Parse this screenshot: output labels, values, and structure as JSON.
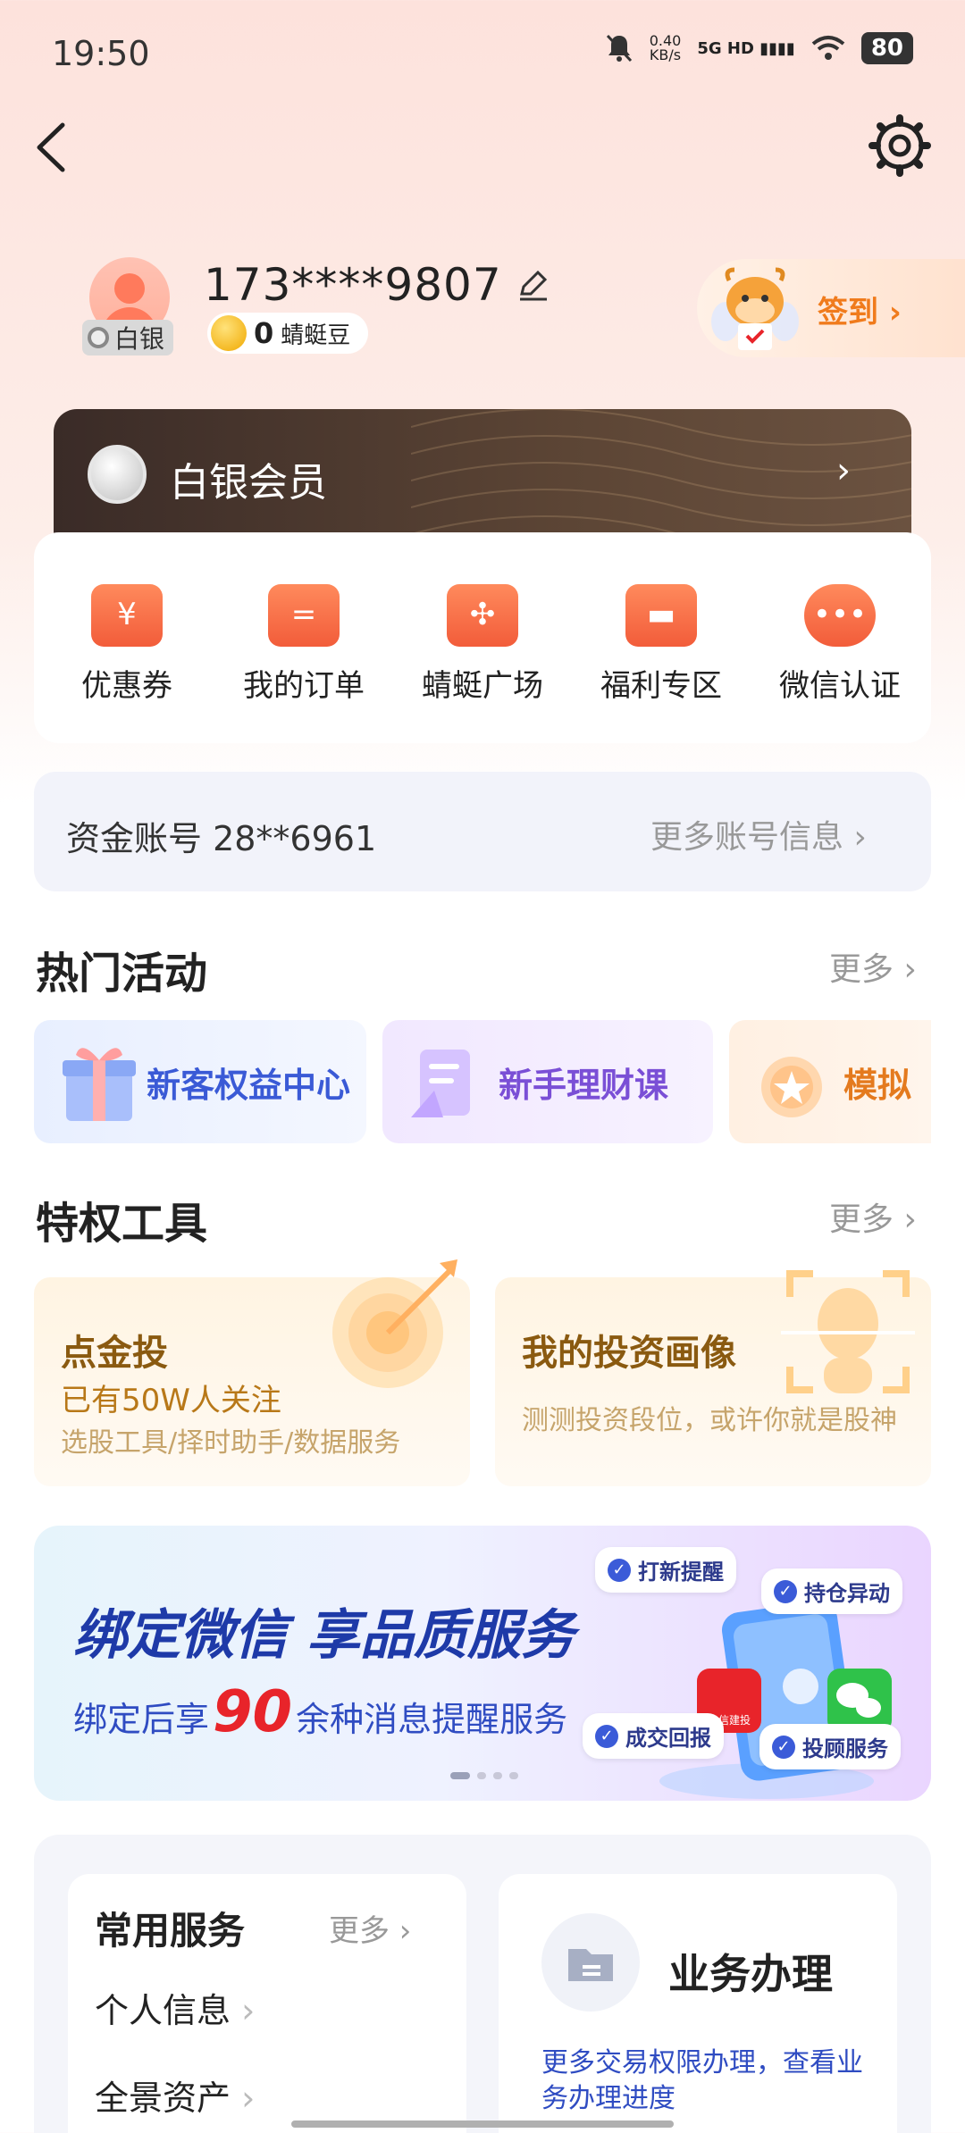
{
  "status_bar": {
    "time": "19:50",
    "net_speed_value": "0.40",
    "net_speed_unit": "KB/s",
    "network": "5G HD",
    "battery": "80"
  },
  "profile": {
    "phone": "173****9807",
    "tier": "白银",
    "beans_count": "0",
    "beans_label": "蜻蜓豆",
    "checkin_label": "签到"
  },
  "member": {
    "label": "白银会员"
  },
  "quick_actions": [
    {
      "label": "优惠券",
      "icon": "coupon-icon"
    },
    {
      "label": "我的订单",
      "icon": "order-icon"
    },
    {
      "label": "蜻蜓广场",
      "icon": "dragonfly-square-icon"
    },
    {
      "label": "福利专区",
      "icon": "gift-icon"
    },
    {
      "label": "微信认证",
      "icon": "wechat-verify-icon"
    }
  ],
  "fund_account": {
    "label": "资金账号 28**6961",
    "more": "更多账号信息"
  },
  "hot_activities": {
    "title": "热门活动",
    "more": "更多",
    "items": [
      "新客权益中心",
      "新手理财课",
      "模拟"
    ]
  },
  "privilege_tools": {
    "title": "特权工具",
    "more": "更多",
    "items": [
      {
        "title": "点金投",
        "subtitle": "已有50W人关注",
        "desc": "选股工具/择时助手/数据服务"
      },
      {
        "title": "我的投资画像",
        "desc": "测测投资段位，或许你就是股神"
      }
    ]
  },
  "banner": {
    "title": "绑定微信 享品质服务",
    "sub_prefix": "绑定后享",
    "sub_number": "90",
    "sub_suffix": "余种消息提醒服务",
    "tags": [
      "打新提醒",
      "持仓异动",
      "成交回报",
      "投顾服务"
    ],
    "app_badge": "中信建投"
  },
  "common_services": {
    "title": "常用服务",
    "more": "更多",
    "items": [
      "个人信息",
      "全景资产"
    ]
  },
  "business": {
    "title": "业务办理",
    "desc": "更多交易权限办理，查看业务办理进度"
  },
  "colors": {
    "accent_orange": "#f07b1c",
    "icon_red": "#f25c3a",
    "banner_blue": "#1e3aa8",
    "banner_red": "#e8242a"
  }
}
